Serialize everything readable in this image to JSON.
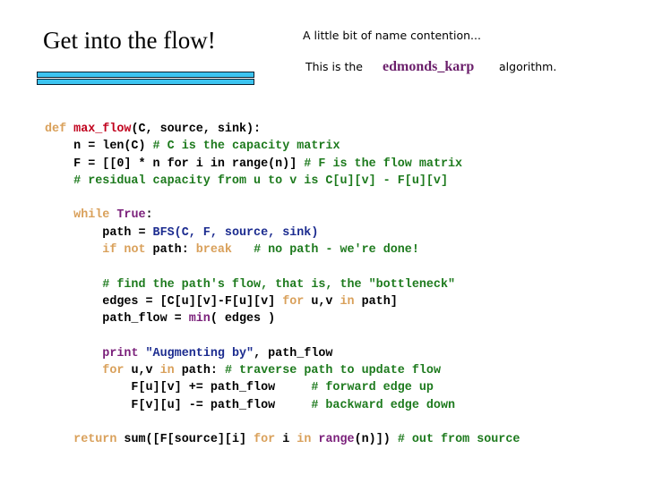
{
  "slide": {
    "title": "Get into the flow!",
    "note_line1": "A little bit of name contention...",
    "note_line2_prefix": "This is the",
    "algorithm_name": "edmonds_karp",
    "note_line2_suffix": "algorithm.",
    "accent_color": "#3cc4f0",
    "algorithm_color": "#6b1f6b"
  },
  "code": {
    "lines": [
      [
        {
          "t": "def ",
          "c": "kw"
        },
        {
          "t": "max_flow",
          "c": "fn"
        },
        {
          "t": "(C, source, sink):",
          "c": ""
        }
      ],
      [
        {
          "t": "    n = len(C) ",
          "c": ""
        },
        {
          "t": "# C is the capacity matrix",
          "c": "cm"
        }
      ],
      [
        {
          "t": "    F = [[0] * n for i in range(n)] ",
          "c": ""
        },
        {
          "t": "# F is the flow matrix",
          "c": "cm"
        }
      ],
      [
        {
          "t": "    # residual capacity from u to v is C[u][v] - F[u][v]",
          "c": "cm"
        }
      ],
      [],
      [
        {
          "t": "    ",
          "c": ""
        },
        {
          "t": "while ",
          "c": "kw"
        },
        {
          "t": "True",
          "c": "bi"
        },
        {
          "t": ":",
          "c": ""
        }
      ],
      [
        {
          "t": "        path = ",
          "c": ""
        },
        {
          "t": "BFS(C, F, source, sink)",
          "c": "call"
        }
      ],
      [
        {
          "t": "        ",
          "c": ""
        },
        {
          "t": "if not ",
          "c": "kw"
        },
        {
          "t": "path: ",
          "c": ""
        },
        {
          "t": "break",
          "c": "kw"
        },
        {
          "t": "   ",
          "c": ""
        },
        {
          "t": "# no path - we're done!",
          "c": "cm"
        }
      ],
      [],
      [
        {
          "t": "        # find the path's flow, that is, the \"bottleneck\"",
          "c": "cm"
        }
      ],
      [
        {
          "t": "        edges = [C[u][v]-F[u][v] ",
          "c": ""
        },
        {
          "t": "for ",
          "c": "kw"
        },
        {
          "t": "u,v ",
          "c": ""
        },
        {
          "t": "in ",
          "c": "kw"
        },
        {
          "t": "path]",
          "c": ""
        }
      ],
      [
        {
          "t": "        path_flow = ",
          "c": ""
        },
        {
          "t": "min",
          "c": "bi"
        },
        {
          "t": "( edges )",
          "c": ""
        }
      ],
      [],
      [
        {
          "t": "        ",
          "c": ""
        },
        {
          "t": "print ",
          "c": "bi"
        },
        {
          "t": "\"Augmenting by\"",
          "c": "str"
        },
        {
          "t": ", path_flow",
          "c": ""
        }
      ],
      [
        {
          "t": "        ",
          "c": ""
        },
        {
          "t": "for ",
          "c": "kw"
        },
        {
          "t": "u,v ",
          "c": ""
        },
        {
          "t": "in ",
          "c": "kw"
        },
        {
          "t": "path: ",
          "c": ""
        },
        {
          "t": "# traverse path to update flow",
          "c": "cm"
        }
      ],
      [
        {
          "t": "            F[u][v] += path_flow     ",
          "c": ""
        },
        {
          "t": "# forward edge up",
          "c": "cm"
        }
      ],
      [
        {
          "t": "            F[v][u] -= path_flow     ",
          "c": ""
        },
        {
          "t": "# backward edge down",
          "c": "cm"
        }
      ],
      [],
      [
        {
          "t": "    ",
          "c": ""
        },
        {
          "t": "return ",
          "c": "kw"
        },
        {
          "t": "sum([F[source][i] ",
          "c": ""
        },
        {
          "t": "for ",
          "c": "kw"
        },
        {
          "t": "i ",
          "c": ""
        },
        {
          "t": "in ",
          "c": "kw"
        },
        {
          "t": "range",
          "c": "bi"
        },
        {
          "t": "(n)]) ",
          "c": ""
        },
        {
          "t": "# out from source",
          "c": "cm"
        }
      ]
    ]
  }
}
